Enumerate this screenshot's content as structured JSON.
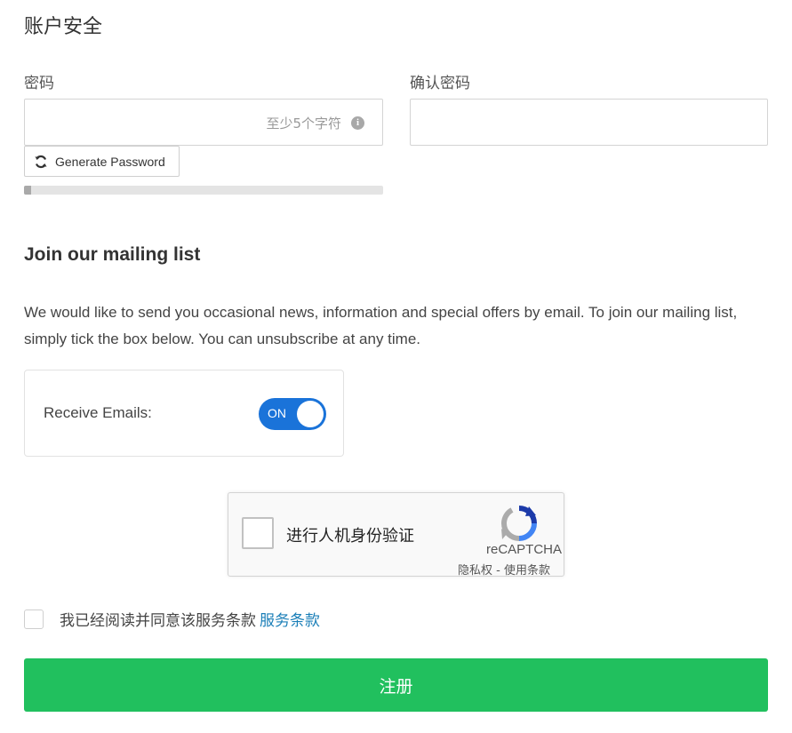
{
  "section": {
    "title": "账户安全"
  },
  "password": {
    "label": "密码",
    "value": "",
    "hint": "至少5个字符",
    "info_icon": "info-circle-icon",
    "generate_label": "Generate Password",
    "generate_icon": "refresh-icon",
    "strength": 0.02
  },
  "confirm_password": {
    "label": "确认密码",
    "value": ""
  },
  "mailing": {
    "title": "Join our mailing list",
    "description": "We would like to send you occasional news, information and special offers by email. To join our mailing list, simply tick the box below. You can unsubscribe at any time.",
    "toggle_label": "Receive Emails:",
    "toggle_state": "ON",
    "toggle_color": "#1a73d9"
  },
  "recaptcha": {
    "text": "进行人机身份验证",
    "brand": "reCAPTCHA",
    "privacy": "隐私权",
    "separator": "-",
    "terms": "使用条款",
    "logo_icon": "recaptcha-logo-icon"
  },
  "terms": {
    "text": "我已经阅读并同意该服务条款",
    "link": "服务条款",
    "link_color": "#1b7fb8"
  },
  "submit": {
    "label": "注册",
    "color": "#21c05e"
  }
}
